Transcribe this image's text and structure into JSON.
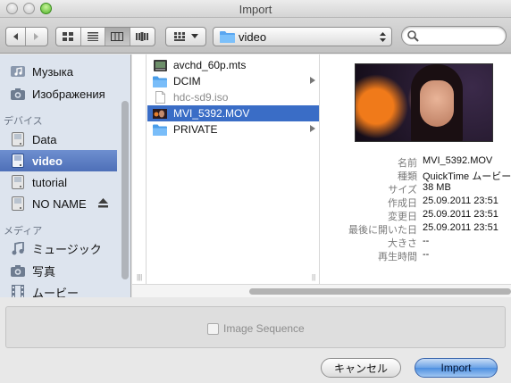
{
  "window": {
    "title": "Import"
  },
  "toolbar": {
    "location": "video",
    "search": {
      "value": "",
      "placeholder": ""
    }
  },
  "sidebar": {
    "items": [
      {
        "label": "Музыка",
        "icon": "music-folder-icon"
      },
      {
        "label": "Изображения",
        "icon": "camera-icon"
      },
      {
        "label": "デバイス",
        "type": "header"
      },
      {
        "label": "Data",
        "icon": "disk-icon"
      },
      {
        "label": "video",
        "icon": "disk-icon",
        "selected": true
      },
      {
        "label": "tutorial",
        "icon": "disk-icon"
      },
      {
        "label": "NO NAME",
        "icon": "disk-icon",
        "eject": true
      },
      {
        "label": "メディア",
        "type": "header"
      },
      {
        "label": "ミュージック",
        "icon": "music-note-icon"
      },
      {
        "label": "写真",
        "icon": "camera-icon"
      },
      {
        "label": "ムービー",
        "icon": "film-icon"
      }
    ]
  },
  "files": [
    {
      "name": "avchd_60p.mts",
      "icon": "video-file-icon"
    },
    {
      "name": "DCIM",
      "icon": "folder-icon",
      "folder": true
    },
    {
      "name": "hdc-sd9.iso",
      "icon": "document-icon",
      "dimmed": true
    },
    {
      "name": "MVI_5392.MOV",
      "icon": "movie-file-icon",
      "selected": true
    },
    {
      "name": "PRIVATE",
      "icon": "folder-icon",
      "folder": true
    }
  ],
  "preview": {
    "info": [
      {
        "key": "名前",
        "value": "MVI_5392.MOV"
      },
      {
        "key": "種類",
        "value": "QuickTime ムービー"
      },
      {
        "key": "サイズ",
        "value": "38 MB"
      },
      {
        "key": "作成日",
        "value": "25.09.2011 23:51"
      },
      {
        "key": "変更日",
        "value": "25.09.2011 23:51"
      },
      {
        "key": "最後に開いた日",
        "value": "25.09.2011 23:51"
      },
      {
        "key": "大きさ",
        "value": "--"
      },
      {
        "key": "再生時間",
        "value": "--"
      }
    ]
  },
  "options": {
    "image_sequence_label": "Image Sequence",
    "image_sequence_checked": false
  },
  "buttons": {
    "cancel": "キャンセル",
    "import": "Import"
  },
  "colors": {
    "selection": "#3a6dc6",
    "sidebar_bg": "#dde4ee",
    "default_button": "#4d8fe0"
  }
}
